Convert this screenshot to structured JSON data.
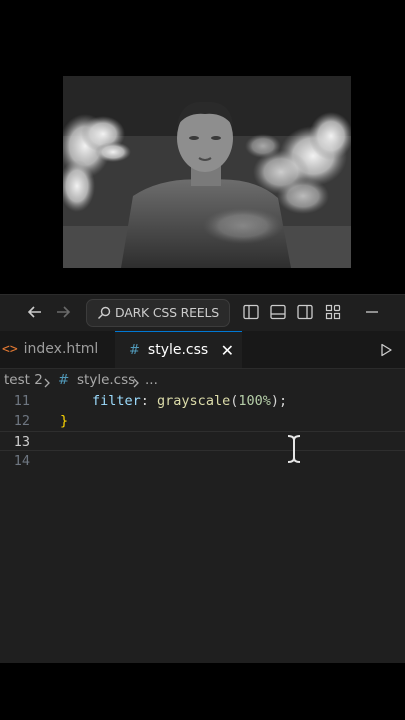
{
  "titlebar": {
    "search_label": "DARK CSS REELS"
  },
  "tabs": [
    {
      "label": "index.html",
      "icon": "html-file-icon",
      "icon_glyph": "<>",
      "active": false
    },
    {
      "label": "style.css",
      "icon": "css-file-icon",
      "icon_glyph": "#",
      "active": true,
      "close_glyph": "✕"
    }
  ],
  "breadcrumb": {
    "folder": "test 2",
    "file_icon": "#",
    "file": "style.css",
    "more": "..."
  },
  "editor": {
    "lines": [
      {
        "number": "11",
        "property": "filter",
        "colon": ": ",
        "function": "grayscale",
        "open": "(",
        "value": "100%",
        "close": ");"
      },
      {
        "number": "12",
        "text": "}"
      },
      {
        "number": "13",
        "text": ""
      },
      {
        "number": "14",
        "text": ""
      }
    ],
    "current_line": "13"
  },
  "colors": {
    "accent": "#0078d4",
    "editor_bg": "#1f1f1f",
    "html_icon": "#e37933",
    "css_icon": "#519aba"
  }
}
